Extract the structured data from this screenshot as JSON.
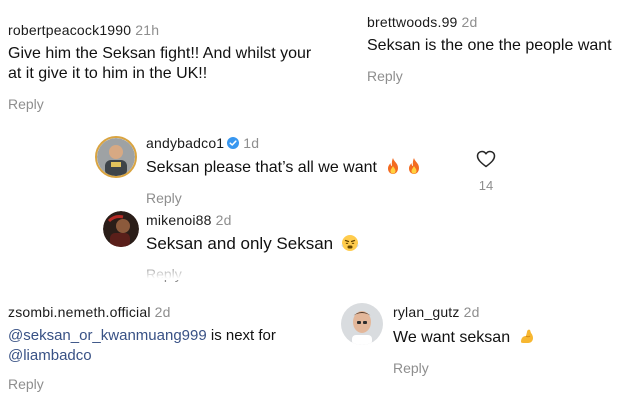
{
  "comments": [
    {
      "id": "robertpeacock",
      "username": "robertpeacock1990",
      "time": "21h",
      "text_line1": "Give him the Seksan fight!! And whilst your",
      "text_line2": "at it give it to him in the UK!!",
      "reply_label": "Reply"
    },
    {
      "id": "brettwoods",
      "username": "brettwoods.99",
      "time": "2d",
      "text": "Seksan is the one the people want",
      "reply_label": "Reply"
    },
    {
      "id": "andybadco",
      "username": "andybadco1",
      "time": "1d",
      "text": "Seksan please that’s all we want",
      "emojis": [
        "fire-emoji",
        "fire-emoji"
      ],
      "reply_label": "Reply",
      "like_count": "14",
      "verified": true
    },
    {
      "id": "mikenoi",
      "username": "mikenoi88",
      "time": "2d",
      "text": "Seksan and only Seksan",
      "emojis": [
        "steaming-face-emoji"
      ],
      "reply_label": "Reply"
    },
    {
      "id": "zsombi",
      "username": "zsombi.nemeth.official",
      "time": "2d",
      "mention": "@seksan_or_kwanmuang999",
      "text_rest": " is next for",
      "mention2": "@liambadco",
      "reply_label": "Reply"
    },
    {
      "id": "rylan",
      "username": "rylan_gutz",
      "time": "2d",
      "text": "We want seksan",
      "emojis": [
        "flexed-biceps-emoji"
      ],
      "reply_label": "Reply"
    }
  ],
  "colors": {
    "mention": "#385185",
    "muted": "#8e8e8e",
    "verified": "#3897f0",
    "text": "#111111"
  }
}
